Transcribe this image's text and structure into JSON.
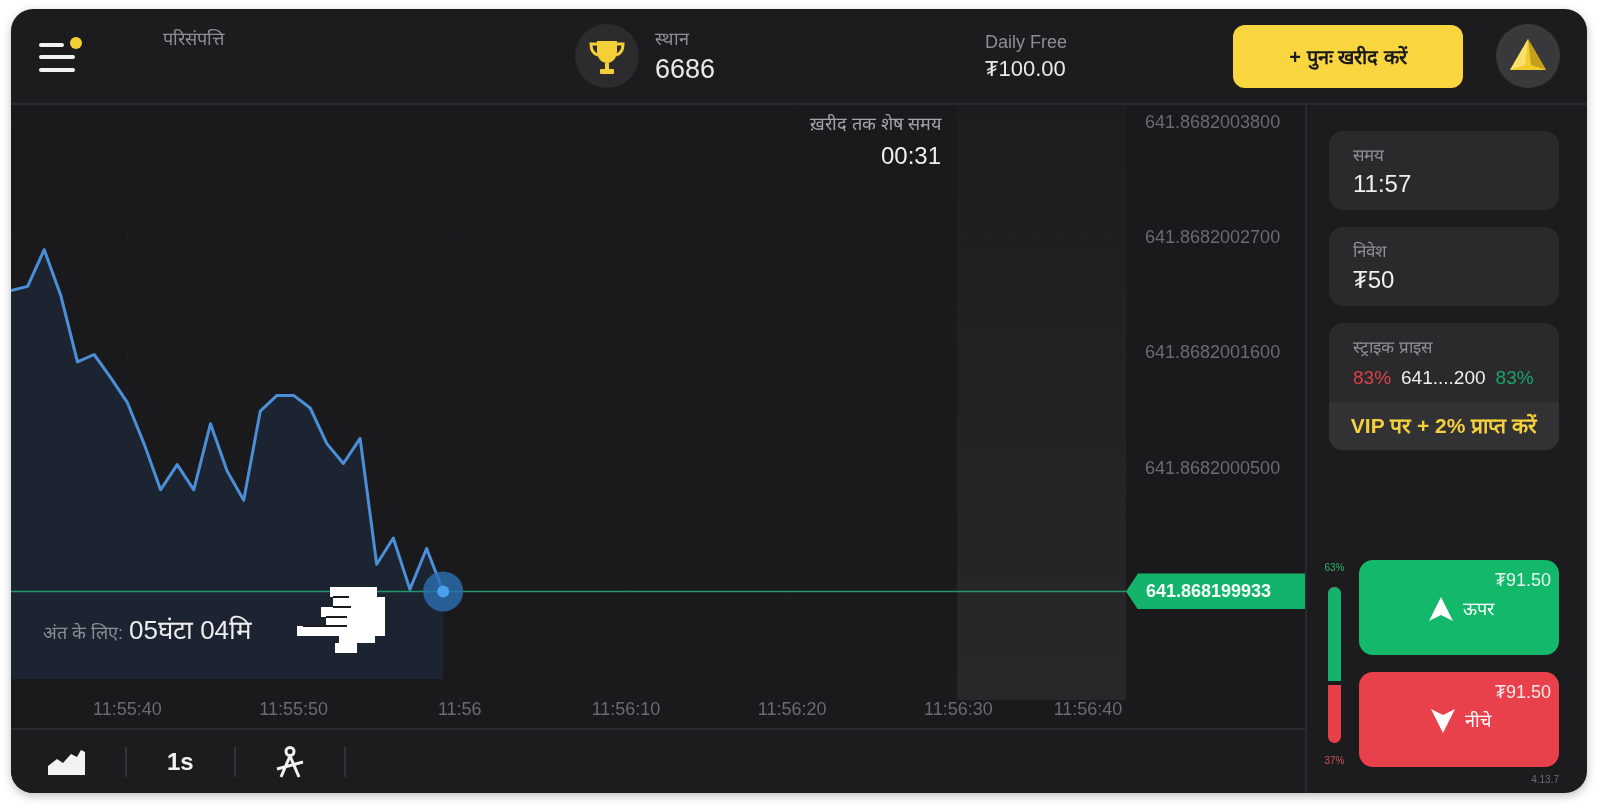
{
  "header": {
    "notification": true,
    "asset_label": "परिसंपत्ति",
    "rank": {
      "label": "स्थान",
      "value": "6686"
    },
    "balance": {
      "label": "Daily Free",
      "value": "₮100.00"
    },
    "top_up_button": "+ पुनः खरीद करें"
  },
  "chart": {
    "purchase_timer": {
      "label": "ख़रीद तक शेष समय",
      "value": "00:31"
    },
    "expiry": {
      "label": "अंत के लिए:",
      "value": "05घंटा 04मि"
    },
    "price_tag": "641.868199933",
    "chart_data": {
      "type": "area",
      "grid": true,
      "categories": [
        null,
        null,
        null,
        null,
        null,
        null,
        null,
        "11:55:40",
        null,
        null,
        null,
        null,
        null,
        null,
        null,
        null,
        null,
        "11:55:50",
        null,
        null,
        null,
        null,
        null,
        null,
        null,
        null,
        null,
        "11:56",
        null,
        null,
        null,
        null,
        null,
        null,
        null,
        null,
        null,
        "11:56:10",
        null,
        null,
        null,
        null,
        null,
        null,
        null,
        null,
        null,
        "11:56:20",
        null,
        null,
        null,
        null,
        null,
        null,
        null,
        null,
        null,
        "11:56:30",
        null,
        null,
        null,
        null,
        null,
        null,
        null,
        null,
        null,
        "11:56:40"
      ],
      "series": [
        {
          "color": "#4a8fd8",
          "values": [
            641.86820022,
            641.868200224,
            641.868200259,
            641.868200215,
            641.868200152,
            641.868200159,
            641.868200137,
            641.868200113,
            641.868200074,
            641.86820003,
            641.868200054,
            641.86820003,
            641.868200093,
            641.868200048,
            641.86820002,
            641.868200105,
            641.86820012,
            641.86820012,
            641.868200108,
            641.868200074,
            641.868200055,
            641.868200079,
            641.868199959,
            641.868199984,
            641.868199935,
            641.868199974,
            641.868199933,
            null,
            null,
            null,
            null,
            null,
            null,
            null,
            null,
            null,
            null,
            null,
            null,
            null,
            null,
            null,
            null,
            null,
            null,
            null,
            null,
            null,
            null,
            null,
            null,
            null,
            null,
            null,
            null,
            null,
            null,
            null,
            null,
            null,
            null,
            null,
            null,
            null,
            null,
            null,
            null,
            null
          ]
        }
      ],
      "ref_lines": [
        {
          "axis": "y",
          "value": 641.868199933,
          "color": "#1f9a68"
        }
      ],
      "ylim": [
        641.868199839,
        641.868200397
      ],
      "yticks": [
        {
          "value": 641.86820038,
          "label": "641.8682003800"
        },
        {
          "value": 641.86820027,
          "label": "641.8682002700"
        },
        {
          "value": 641.86820016,
          "label": "641.8682001600"
        },
        {
          "value": 641.86820005,
          "label": "641.8682000500"
        }
      ]
    }
  },
  "toolbar": {
    "items": [
      {
        "kind": "chart_type"
      },
      {
        "kind": "timeframe",
        "label": "1s"
      },
      {
        "kind": "drawing_tools"
      }
    ]
  },
  "trade_panel": {
    "fields": [
      {
        "label": "समय",
        "value": "11:57"
      },
      {
        "label": "निवेश",
        "value": "₮50"
      }
    ],
    "strike": {
      "label": "स्ट्राइक प्राइस",
      "down_payout": "83%",
      "price": "641....200",
      "up_payout": "83%",
      "promo": "VIP पर + 2% प्राप्त करें"
    },
    "sentiment": {
      "up_share": "63%",
      "level": 0.63,
      "down_share": "37%"
    },
    "buttons": [
      {
        "kind": "up",
        "amount": "₮91.50",
        "label": "ऊपर"
      },
      {
        "kind": "down",
        "amount": "₮91.50",
        "label": "नीचे"
      }
    ],
    "version": "4.13.7"
  }
}
